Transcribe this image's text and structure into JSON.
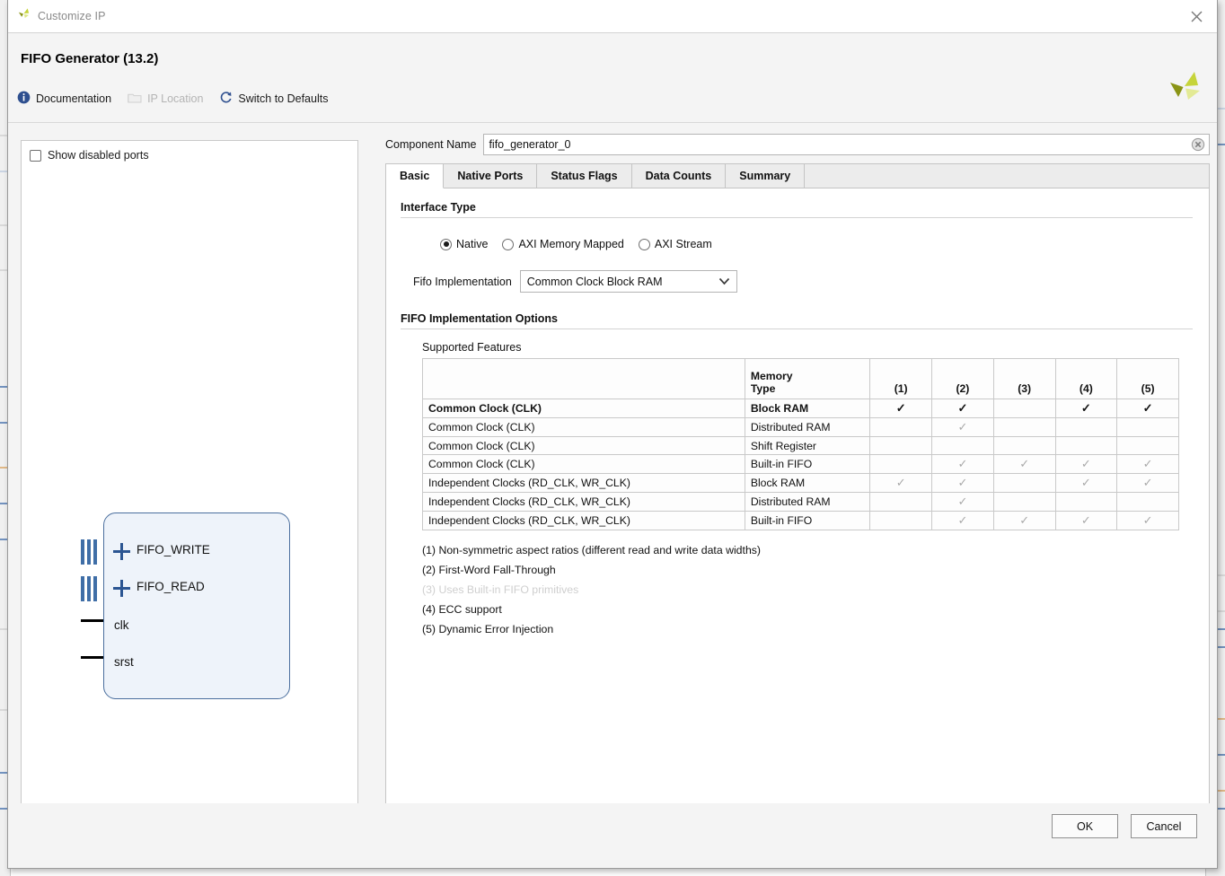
{
  "window": {
    "title": "Customize IP",
    "app_icon": "xilinx-logo-icon",
    "close_icon": "close-icon"
  },
  "header": {
    "ip_title": "FIFO Generator (13.2)",
    "brand_logo": "xilinx-pinwheel-logo",
    "toolbar": [
      {
        "label": "Documentation",
        "icon": "info-icon",
        "disabled": false
      },
      {
        "label": "IP Location",
        "icon": "folder-icon",
        "disabled": true
      },
      {
        "label": "Switch to Defaults",
        "icon": "refresh-icon",
        "disabled": false
      }
    ]
  },
  "preview": {
    "show_disabled_ports_label": "Show disabled ports",
    "show_disabled_ports_checked": false,
    "block_ports": [
      {
        "name": "FIFO_WRITE",
        "kind": "bus-expandable"
      },
      {
        "name": "FIFO_READ",
        "kind": "bus-expandable"
      },
      {
        "name": "clk",
        "kind": "wire"
      },
      {
        "name": "srst",
        "kind": "wire"
      }
    ]
  },
  "component": {
    "label": "Component Name",
    "value": "fifo_generator_0",
    "placeholder": "",
    "clear_icon": "clear-circle-icon"
  },
  "tabs": [
    {
      "label": "Basic",
      "active": true
    },
    {
      "label": "Native Ports",
      "active": false
    },
    {
      "label": "Status Flags",
      "active": false
    },
    {
      "label": "Data Counts",
      "active": false
    },
    {
      "label": "Summary",
      "active": false
    }
  ],
  "basic": {
    "interface_type": {
      "heading": "Interface Type",
      "options": [
        {
          "label": "Native",
          "selected": true
        },
        {
          "label": "AXI Memory Mapped",
          "selected": false
        },
        {
          "label": "AXI Stream",
          "selected": false
        }
      ]
    },
    "fifo_implementation": {
      "label": "Fifo Implementation",
      "value": "Common Clock Block RAM",
      "chevron_icon": "chevron-down-icon"
    },
    "impl_options": {
      "heading": "FIFO Implementation Options",
      "table_caption": "Supported Features",
      "columns": [
        "",
        "Memory\nType",
        "(1)",
        "(2)",
        "(3)",
        "(4)",
        "(5)"
      ],
      "column_headers": {
        "clocking": "",
        "memory_type_line1": "Memory",
        "memory_type_line2": "Type",
        "n1": "(1)",
        "n2": "(2)",
        "n3": "(3)",
        "n4": "(4)",
        "n5": "(5)"
      },
      "rows": [
        {
          "clocking": "Common Clock (CLK)",
          "memory": "Block RAM",
          "highlighted": true,
          "marks": [
            "dark",
            "dark",
            "",
            "dark",
            "dark"
          ]
        },
        {
          "clocking": "Common Clock (CLK)",
          "memory": "Distributed RAM",
          "highlighted": false,
          "marks": [
            "",
            "faint",
            "",
            "",
            ""
          ]
        },
        {
          "clocking": "Common Clock (CLK)",
          "memory": "Shift Register",
          "highlighted": false,
          "marks": [
            "",
            "",
            "",
            "",
            ""
          ]
        },
        {
          "clocking": "Common Clock (CLK)",
          "memory": "Built-in FIFO",
          "highlighted": false,
          "marks": [
            "",
            "faint",
            "faint",
            "faint",
            "faint"
          ]
        },
        {
          "clocking": "Independent Clocks (RD_CLK, WR_CLK)",
          "memory": "Block RAM",
          "highlighted": false,
          "marks": [
            "faint",
            "faint",
            "",
            "faint",
            "faint"
          ]
        },
        {
          "clocking": "Independent Clocks (RD_CLK, WR_CLK)",
          "memory": "Distributed RAM",
          "highlighted": false,
          "marks": [
            "",
            "faint",
            "",
            "",
            ""
          ]
        },
        {
          "clocking": "Independent Clocks (RD_CLK, WR_CLK)",
          "memory": "Built-in FIFO",
          "highlighted": false,
          "marks": [
            "",
            "faint",
            "faint",
            "faint",
            "faint"
          ]
        }
      ],
      "footnotes": [
        {
          "text": "(1) Non-symmetric aspect ratios (different read and write data widths)",
          "muted": false
        },
        {
          "text": "(2) First-Word Fall-Through",
          "muted": false
        },
        {
          "text": "(3) Uses Built-in FIFO primitives",
          "muted": true
        },
        {
          "text": "(4) ECC support",
          "muted": false
        },
        {
          "text": "(5) Dynamic Error Injection",
          "muted": false
        }
      ]
    }
  },
  "footer": {
    "ok_label": "OK",
    "cancel_label": "Cancel"
  },
  "colors": {
    "accent_blue": "#2b5592",
    "brand_yellow_green": "#cddc39",
    "dialog_bg": "#f4f4f4",
    "panel_white": "#ffffff",
    "border_gray": "#c4c4c4",
    "block_fill": "#eef3fa",
    "block_border": "#4b6f9e",
    "disabled_text": "#b4b4b4"
  }
}
